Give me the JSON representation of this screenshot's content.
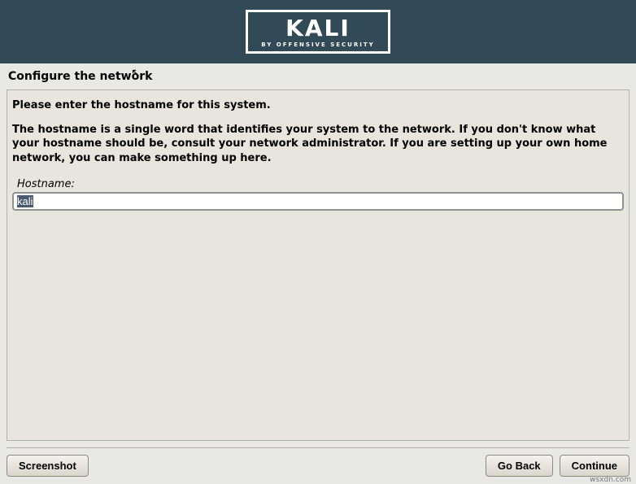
{
  "header": {
    "brand": "KALI",
    "tagline": "BY OFFENSIVE SECURITY"
  },
  "page": {
    "title": "Configure the network",
    "instruction_line1": "Please enter the hostname for this system.",
    "instruction_line2": "The hostname is a single word that identifies your system to the network. If you don't know what your hostname should be, consult your network administrator. If you are setting up your own home network, you can make something up here."
  },
  "form": {
    "hostname_label": "Hostname:",
    "hostname_value": "kali"
  },
  "buttons": {
    "screenshot": "Screenshot",
    "go_back": "Go Back",
    "continue": "Continue"
  },
  "watermark": "wsxdn.com"
}
